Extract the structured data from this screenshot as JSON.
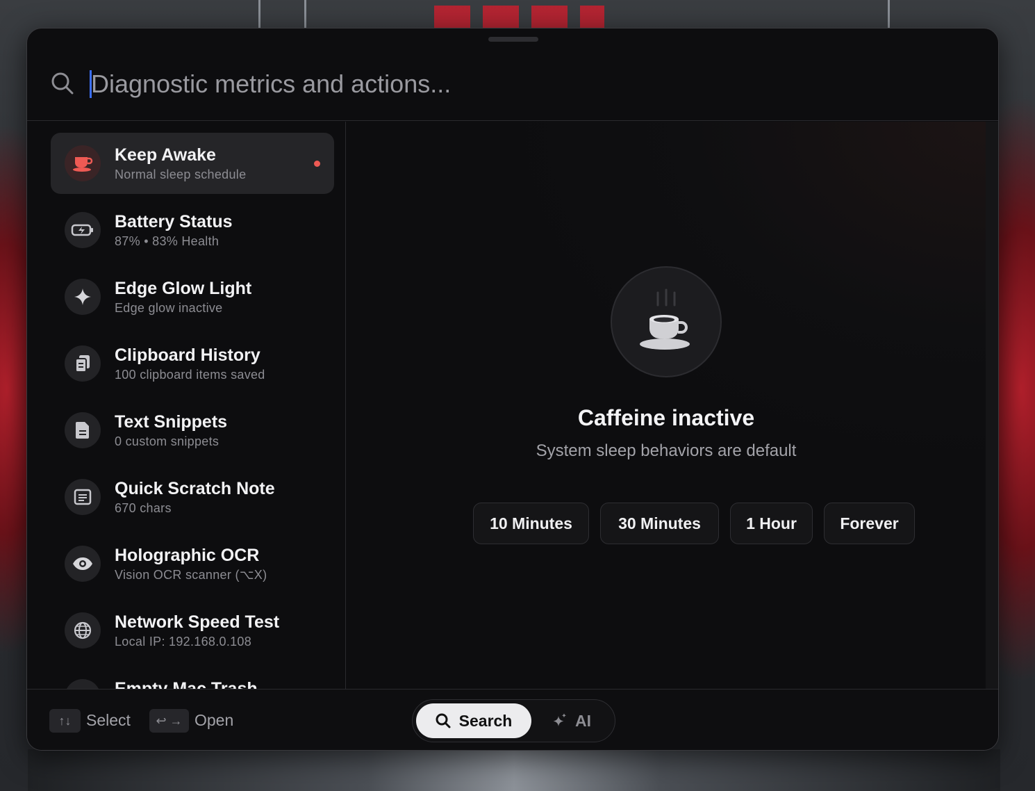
{
  "search": {
    "placeholder": "Diagnostic metrics and actions..."
  },
  "list": {
    "items": [
      {
        "title": "Keep Awake",
        "subtitle": "Normal sleep schedule",
        "icon": "coffee-cup-icon",
        "selected": true
      },
      {
        "title": "Battery Status",
        "subtitle": "87%  •  83% Health",
        "icon": "battery-icon"
      },
      {
        "title": "Edge Glow Light",
        "subtitle": "Edge glow inactive",
        "icon": "sparkle-icon"
      },
      {
        "title": "Clipboard History",
        "subtitle": "100 clipboard items saved",
        "icon": "clipboard-icon"
      },
      {
        "title": "Text Snippets",
        "subtitle": "0 custom snippets",
        "icon": "document-icon"
      },
      {
        "title": "Quick Scratch Note",
        "subtitle": "670 chars",
        "icon": "note-icon"
      },
      {
        "title": "Holographic OCR",
        "subtitle": "Vision OCR scanner (⌥X)",
        "icon": "eye-icon"
      },
      {
        "title": "Network Speed Test",
        "subtitle": "Local IP: 192.168.0.108",
        "icon": "globe-icon"
      },
      {
        "title": "Empty Mac Trash",
        "subtitle": "",
        "icon": "trash-icon"
      }
    ]
  },
  "detail": {
    "title": "Caffeine inactive",
    "subtitle": "System sleep behaviors are default",
    "buttons": [
      "10 Minutes",
      "30 Minutes",
      "1 Hour",
      "Forever"
    ]
  },
  "footer": {
    "select_label": "Select",
    "open_label": "Open",
    "select_key": "↑↓",
    "open_key": "↩ →",
    "mode_search": "Search",
    "mode_ai": "AI"
  },
  "colors": {
    "accent_red": "#ee5a54",
    "caret_blue": "#3b6ef5"
  }
}
